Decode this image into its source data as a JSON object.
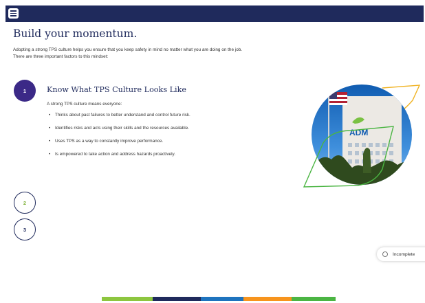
{
  "header": {
    "menu_icon": "hamburger-menu-icon"
  },
  "page_title": "Build your momentum.",
  "intro_line1": "Adopting a strong TPS culture helps you ensure that you keep safety in mind no matter what you are doing on the job.",
  "intro_line2": "There are three important factors to this mindset:",
  "steps": [
    {
      "number": "1",
      "state": "active"
    },
    {
      "number": "2",
      "state": "inactive"
    },
    {
      "number": "3",
      "state": "inactive"
    }
  ],
  "section": {
    "title": "Know What TPS Culture Looks Like",
    "lead": "A strong TPS culture means everyone:",
    "bullets": [
      "Thinks about past failures to better understand and control future risk.",
      "Identifies risks and acts using their skills and the resources available.",
      "Uses TPS as a way to constantly improve performance.",
      "Is empowered to take action and address hazards proactively."
    ]
  },
  "photo": {
    "building_sign": "ADM",
    "accent_colors": [
      "#f0b323",
      "#4bb543"
    ]
  },
  "status": {
    "label": "Incomplete"
  },
  "colors": {
    "header_bg": "#1f2a5c",
    "title": "#1f2a5c",
    "step_active": "#3b2987",
    "stripe": [
      "#8dc63f",
      "#1f2a5c",
      "#1e73be",
      "#f7941d",
      "#4bb543"
    ]
  }
}
